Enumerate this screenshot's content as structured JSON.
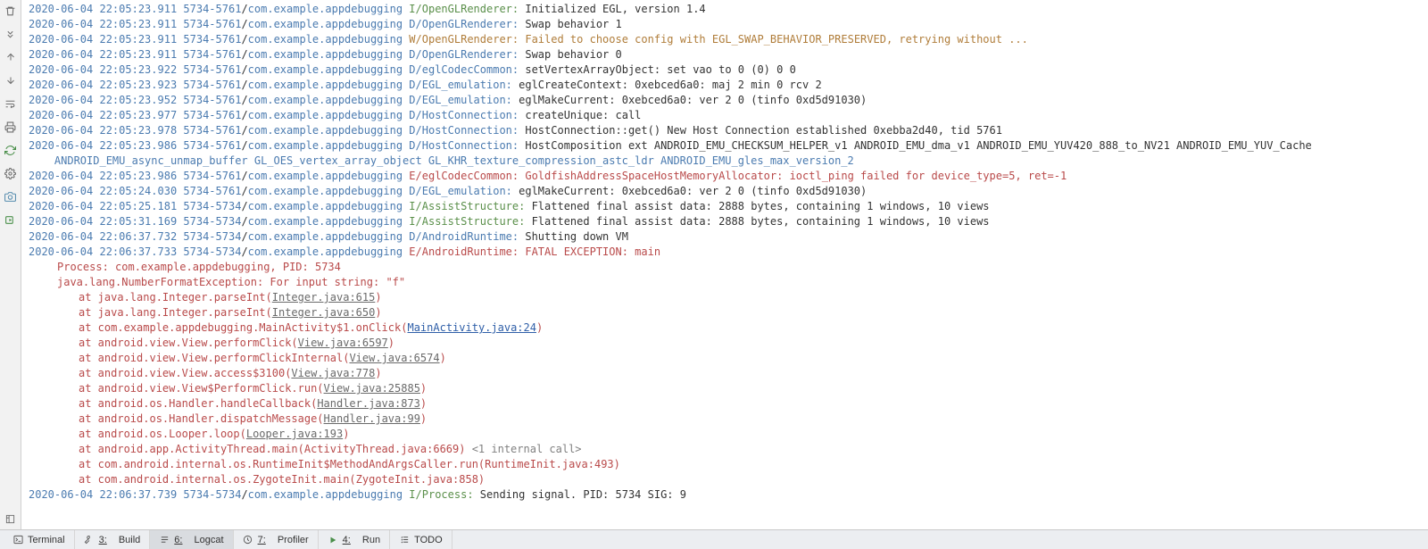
{
  "gutter": {
    "trash": "trash-icon",
    "scroll_end": "scroll-to-end-icon",
    "up": "up-icon",
    "down": "down-icon",
    "wrap": "soft-wrap-icon",
    "print": "print-icon",
    "restart": "restart-icon",
    "settings": "settings-icon",
    "camera": "screenshot-icon",
    "record": "screen-record-icon",
    "expand": "expand-icon",
    "help": "help-icon"
  },
  "logs": [
    {
      "ts": "2020-06-04 22:05:23.911",
      "pid": "5734-5761",
      "pkg": "com.example.appdebugging",
      "lvl": "I",
      "tag": "OpenGLRenderer",
      "msg": "Initialized EGL, version 1.4"
    },
    {
      "ts": "2020-06-04 22:05:23.911",
      "pid": "5734-5761",
      "pkg": "com.example.appdebugging",
      "lvl": "D",
      "tag": "OpenGLRenderer",
      "msg": "Swap behavior 1"
    },
    {
      "ts": "2020-06-04 22:05:23.911",
      "pid": "5734-5761",
      "pkg": "com.example.appdebugging",
      "lvl": "W",
      "tag": "OpenGLRenderer",
      "msg": "Failed to choose config with EGL_SWAP_BEHAVIOR_PRESERVED, retrying without ..."
    },
    {
      "ts": "2020-06-04 22:05:23.911",
      "pid": "5734-5761",
      "pkg": "com.example.appdebugging",
      "lvl": "D",
      "tag": "OpenGLRenderer",
      "msg": "Swap behavior 0"
    },
    {
      "ts": "2020-06-04 22:05:23.922",
      "pid": "5734-5761",
      "pkg": "com.example.appdebugging",
      "lvl": "D",
      "tag": "eglCodecCommon",
      "msg": "setVertexArrayObject: set vao to 0 (0) 0 0"
    },
    {
      "ts": "2020-06-04 22:05:23.923",
      "pid": "5734-5761",
      "pkg": "com.example.appdebugging",
      "lvl": "D",
      "tag": "EGL_emulation",
      "msg": "eglCreateContext: 0xebced6a0: maj 2 min 0 rcv 2"
    },
    {
      "ts": "2020-06-04 22:05:23.952",
      "pid": "5734-5761",
      "pkg": "com.example.appdebugging",
      "lvl": "D",
      "tag": "EGL_emulation",
      "msg": "eglMakeCurrent: 0xebced6a0: ver 2 0 (tinfo 0xd5d91030)"
    },
    {
      "ts": "2020-06-04 22:05:23.977",
      "pid": "5734-5761",
      "pkg": "com.example.appdebugging",
      "lvl": "D",
      "tag": "HostConnection",
      "msg": "createUnique: call"
    },
    {
      "ts": "2020-06-04 22:05:23.978",
      "pid": "5734-5761",
      "pkg": "com.example.appdebugging",
      "lvl": "D",
      "tag": "HostConnection",
      "msg": "HostConnection::get() New Host Connection established 0xebba2d40, tid 5761"
    },
    {
      "ts": "2020-06-04 22:05:23.986",
      "pid": "5734-5761",
      "pkg": "com.example.appdebugging",
      "lvl": "D",
      "tag": "HostConnection",
      "msg": "HostComposition ext ANDROID_EMU_CHECKSUM_HELPER_v1 ANDROID_EMU_dma_v1 ANDROID_EMU_YUV420_888_to_NV21 ANDROID_EMU_YUV_Cache"
    },
    {
      "cont": "    ANDROID_EMU_async_unmap_buffer GL_OES_vertex_array_object GL_KHR_texture_compression_astc_ldr ANDROID_EMU_gles_max_version_2",
      "lvl": "D"
    },
    {
      "ts": "2020-06-04 22:05:23.986",
      "pid": "5734-5761",
      "pkg": "com.example.appdebugging",
      "lvl": "E",
      "tag": "eglCodecCommon",
      "msg": "GoldfishAddressSpaceHostMemoryAllocator: ioctl_ping failed for device_type=5, ret=-1"
    },
    {
      "ts": "2020-06-04 22:05:24.030",
      "pid": "5734-5761",
      "pkg": "com.example.appdebugging",
      "lvl": "D",
      "tag": "EGL_emulation",
      "msg": "eglMakeCurrent: 0xebced6a0: ver 2 0 (tinfo 0xd5d91030)"
    },
    {
      "ts": "2020-06-04 22:05:25.181",
      "pid": "5734-5734",
      "pkg": "com.example.appdebugging",
      "lvl": "I",
      "tag": "AssistStructure",
      "msg": "Flattened final assist data: 2888 bytes, containing 1 windows, 10 views"
    },
    {
      "ts": "2020-06-04 22:05:31.169",
      "pid": "5734-5734",
      "pkg": "com.example.appdebugging",
      "lvl": "I",
      "tag": "AssistStructure",
      "msg": "Flattened final assist data: 2888 bytes, containing 1 windows, 10 views"
    },
    {
      "ts": "2020-06-04 22:06:37.732",
      "pid": "5734-5734",
      "pkg": "com.example.appdebugging",
      "lvl": "D",
      "tag": "AndroidRuntime",
      "msg": "Shutting down VM"
    },
    {
      "ts": "2020-06-04 22:06:37.733",
      "pid": "5734-5734",
      "pkg": "com.example.appdebugging",
      "lvl": "E",
      "tag": "AndroidRuntime",
      "msg": "FATAL EXCEPTION: main"
    }
  ],
  "exception": {
    "process": "Process: com.example.appdebugging, PID: 5734",
    "headline": "java.lang.NumberFormatException: For input string: \"f\"",
    "frames": [
      {
        "pre": "at java.lang.Integer.parseInt(",
        "file": "Integer.java:615",
        "post": ")",
        "style": "link"
      },
      {
        "pre": "at java.lang.Integer.parseInt(",
        "file": "Integer.java:650",
        "post": ")",
        "style": "link"
      },
      {
        "pre": "at com.example.appdebugging.MainActivity$1.onClick(",
        "file": "MainActivity.java:24",
        "post": ")",
        "style": "link-blue"
      },
      {
        "pre": "at android.view.View.performClick(",
        "file": "View.java:6597",
        "post": ")",
        "style": "link"
      },
      {
        "pre": "at android.view.View.performClickInternal(",
        "file": "View.java:6574",
        "post": ")",
        "style": "link"
      },
      {
        "pre": "at android.view.View.access$3100(",
        "file": "View.java:778",
        "post": ")",
        "style": "link"
      },
      {
        "pre": "at android.view.View$PerformClick.run(",
        "file": "View.java:25885",
        "post": ")",
        "style": "link"
      },
      {
        "pre": "at android.os.Handler.handleCallback(",
        "file": "Handler.java:873",
        "post": ")",
        "style": "link"
      },
      {
        "pre": "at android.os.Handler.dispatchMessage(",
        "file": "Handler.java:99",
        "post": ")",
        "style": "link"
      },
      {
        "pre": "at android.os.Looper.loop(",
        "file": "Looper.java:193",
        "post": ")",
        "style": "link"
      },
      {
        "pre": "at android.app.ActivityThread.main(ActivityThread.java:6669)",
        "extra": " <1 internal call>",
        "style": "plain-extra"
      },
      {
        "pre": "at com.android.internal.os.RuntimeInit$MethodAndArgsCaller.run(RuntimeInit.java:493)",
        "style": "plain"
      },
      {
        "pre": "at com.android.internal.os.ZygoteInit.main(ZygoteInit.java:858)",
        "style": "plain"
      }
    ]
  },
  "final_log": {
    "ts": "2020-06-04 22:06:37.739",
    "pid": "5734-5734",
    "pkg": "com.example.appdebugging",
    "lvl": "I",
    "tag": "Process",
    "msg": "Sending signal. PID: 5734 SIG: 9"
  },
  "tabs": {
    "terminal": {
      "label": "Terminal",
      "key": ""
    },
    "build": {
      "label": "Build",
      "key": "3:"
    },
    "logcat": {
      "label": "Logcat",
      "key": "6:"
    },
    "profiler": {
      "label": "Profiler",
      "key": "7:"
    },
    "run": {
      "label": "Run",
      "key": "4:"
    },
    "todo": {
      "label": "TODO",
      "key": ""
    }
  }
}
